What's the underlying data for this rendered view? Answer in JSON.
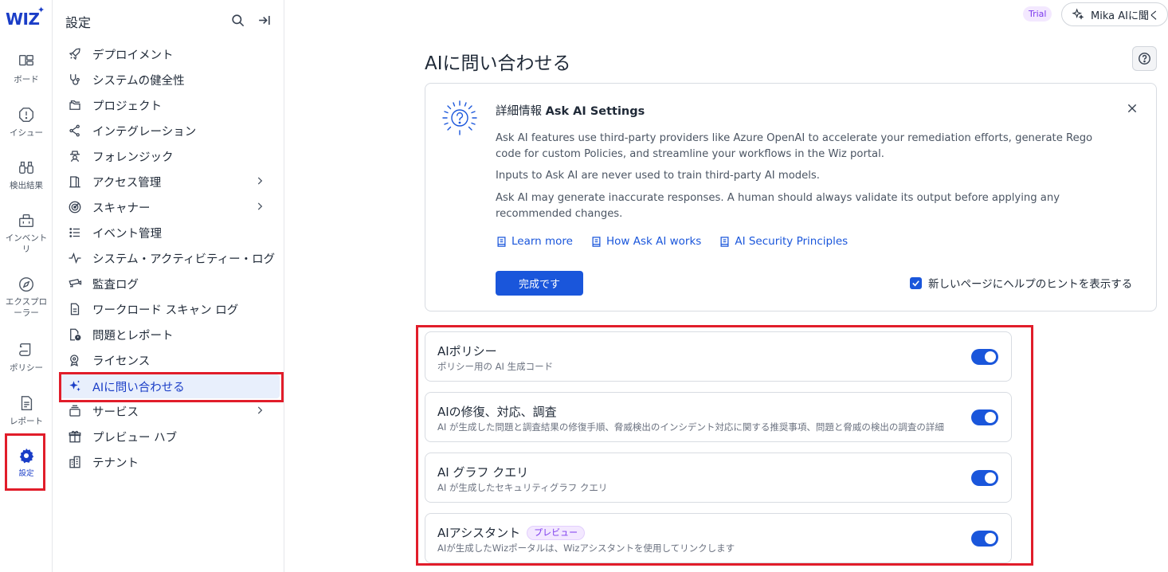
{
  "app": {
    "logo": "WIZ",
    "colors": {
      "accent": "#1a56db",
      "brand": "#1a3dc7",
      "highlight": "#e11d2a",
      "preview_badge": "#7c3aed"
    }
  },
  "rail": {
    "items": [
      {
        "label": "ボード",
        "icon": "board-icon"
      },
      {
        "label": "イシュー",
        "icon": "issue-icon"
      },
      {
        "label": "検出結果",
        "icon": "binoculars-icon"
      },
      {
        "label": "インベント リ",
        "icon": "inventory-icon"
      },
      {
        "label": "エクスプロ ーラー",
        "icon": "compass-icon"
      },
      {
        "label": "ポリシー",
        "icon": "scroll-icon"
      },
      {
        "label": "レポート",
        "icon": "report-icon"
      },
      {
        "label": "設定",
        "icon": "gear-icon",
        "active": true
      }
    ]
  },
  "nav": {
    "title": "設定",
    "items": [
      {
        "label": "デプロイメント",
        "icon": "rocket-icon"
      },
      {
        "label": "システムの健全性",
        "icon": "stethoscope-icon"
      },
      {
        "label": "プロジェクト",
        "icon": "folders-icon"
      },
      {
        "label": "インテグレーション",
        "icon": "integration-icon"
      },
      {
        "label": "フォレンジック",
        "icon": "detective-icon"
      },
      {
        "label": "アクセス管理",
        "icon": "door-icon",
        "has_submenu": true
      },
      {
        "label": "スキャナー",
        "icon": "scanner-icon",
        "has_submenu": true
      },
      {
        "label": "イベント管理",
        "icon": "list-icon"
      },
      {
        "label": "システム・アクティビティー・ログ",
        "icon": "activity-icon"
      },
      {
        "label": "監査ログ",
        "icon": "camera-icon"
      },
      {
        "label": "ワークロード スキャン ログ",
        "icon": "file-icon"
      },
      {
        "label": "問題とレポート",
        "icon": "file-alert-icon"
      },
      {
        "label": "ライセンス",
        "icon": "license-icon"
      },
      {
        "label": "AIに問い合わせる",
        "icon": "sparkle-icon",
        "active": true
      },
      {
        "label": "サービス",
        "icon": "service-icon",
        "has_submenu": true
      },
      {
        "label": "プレビュー ハブ",
        "icon": "gift-icon"
      },
      {
        "label": "テナント",
        "icon": "building-icon"
      }
    ]
  },
  "header": {
    "trial_badge": "Trial",
    "mika_button": "Mika AIに聞く"
  },
  "main": {
    "title": "AIに問い合わせる",
    "info": {
      "title_prefix": "詳細情報 ",
      "title_bold": "Ask AI Settings",
      "paragraphs": [
        "Ask AI features use third-party providers like Azure OpenAI to accelerate your remediation efforts, generate Rego code for custom Policies, and streamline your workflows in the Wiz portal.",
        "Inputs to Ask AI are never used to train third-party AI models.",
        "Ask AI may generate inaccurate responses. A human should always validate its output before applying any recommended changes."
      ],
      "links": [
        "Learn more",
        "How Ask AI works",
        "AI Security Principles"
      ],
      "done_button": "完成です",
      "hint_checkbox": "新しいページにヘルプのヒントを表示する",
      "hint_checked": true
    },
    "toggles": [
      {
        "title": "AIポリシー",
        "desc": "ポリシー用の AI 生成コード",
        "on": true
      },
      {
        "title": "AIの修復、対応、調査",
        "desc": "AI が生成した問題と調査結果の修復手順、脅威検出のインシデント対応に関する推奨事項、問題と脅威の検出の調査の詳細",
        "on": true
      },
      {
        "title": "AI グラフ クエリ",
        "desc": "AI が生成したセキュリティグラフ クエリ",
        "on": true
      },
      {
        "title": "AIアシスタント",
        "badge": "プレビュー",
        "desc": "AIが生成したWizポータルは、Wizアシスタントを使用してリンクします",
        "on": true
      }
    ]
  }
}
